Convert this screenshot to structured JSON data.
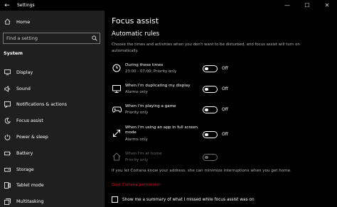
{
  "window": {
    "title": "Settings"
  },
  "sidebar": {
    "home_label": "Home",
    "search_placeholder": "Find a setting",
    "section": "System",
    "items": [
      {
        "label": "Display",
        "icon": "display-icon"
      },
      {
        "label": "Sound",
        "icon": "sound-icon"
      },
      {
        "label": "Notifications & actions",
        "icon": "notifications-icon"
      },
      {
        "label": "Focus assist",
        "icon": "focus-assist-icon"
      },
      {
        "label": "Power & sleep",
        "icon": "power-icon"
      },
      {
        "label": "Battery",
        "icon": "battery-icon"
      },
      {
        "label": "Storage",
        "icon": "storage-icon"
      },
      {
        "label": "Tablet mode",
        "icon": "tablet-icon"
      },
      {
        "label": "Multitasking",
        "icon": "multitasking-icon"
      }
    ]
  },
  "content": {
    "title": "Focus assist",
    "subtitle": "Automatic rules",
    "description": "Choose the times and activities when you don't want to be disturbed, and focus assist will turn on automatically.",
    "rules": [
      {
        "title": "During these times",
        "subtitle": "23:00 - 07:00; Priority only",
        "state": "Off",
        "icon": "clock-icon"
      },
      {
        "title": "When I'm duplicating my display",
        "subtitle": "Alarms only",
        "state": "Off",
        "icon": "monitor-icon"
      },
      {
        "title": "When I'm playing a game",
        "subtitle": "Priority only",
        "state": "Off",
        "icon": "gamepad-icon"
      },
      {
        "title": "When I'm using an app in full screen mode",
        "subtitle": "Alarms only",
        "state": "Off",
        "icon": "fullscreen-icon"
      },
      {
        "title": "When I'm at home",
        "subtitle": "Priority only",
        "state": "",
        "icon": "home-icon"
      }
    ],
    "cortana_text": "If you let Cortana know your address, she can minimize interruptions when you get home.",
    "cortana_link": "Give Cortana permission",
    "summary_label": "Show me a summary of what I missed while focus assist was on"
  }
}
